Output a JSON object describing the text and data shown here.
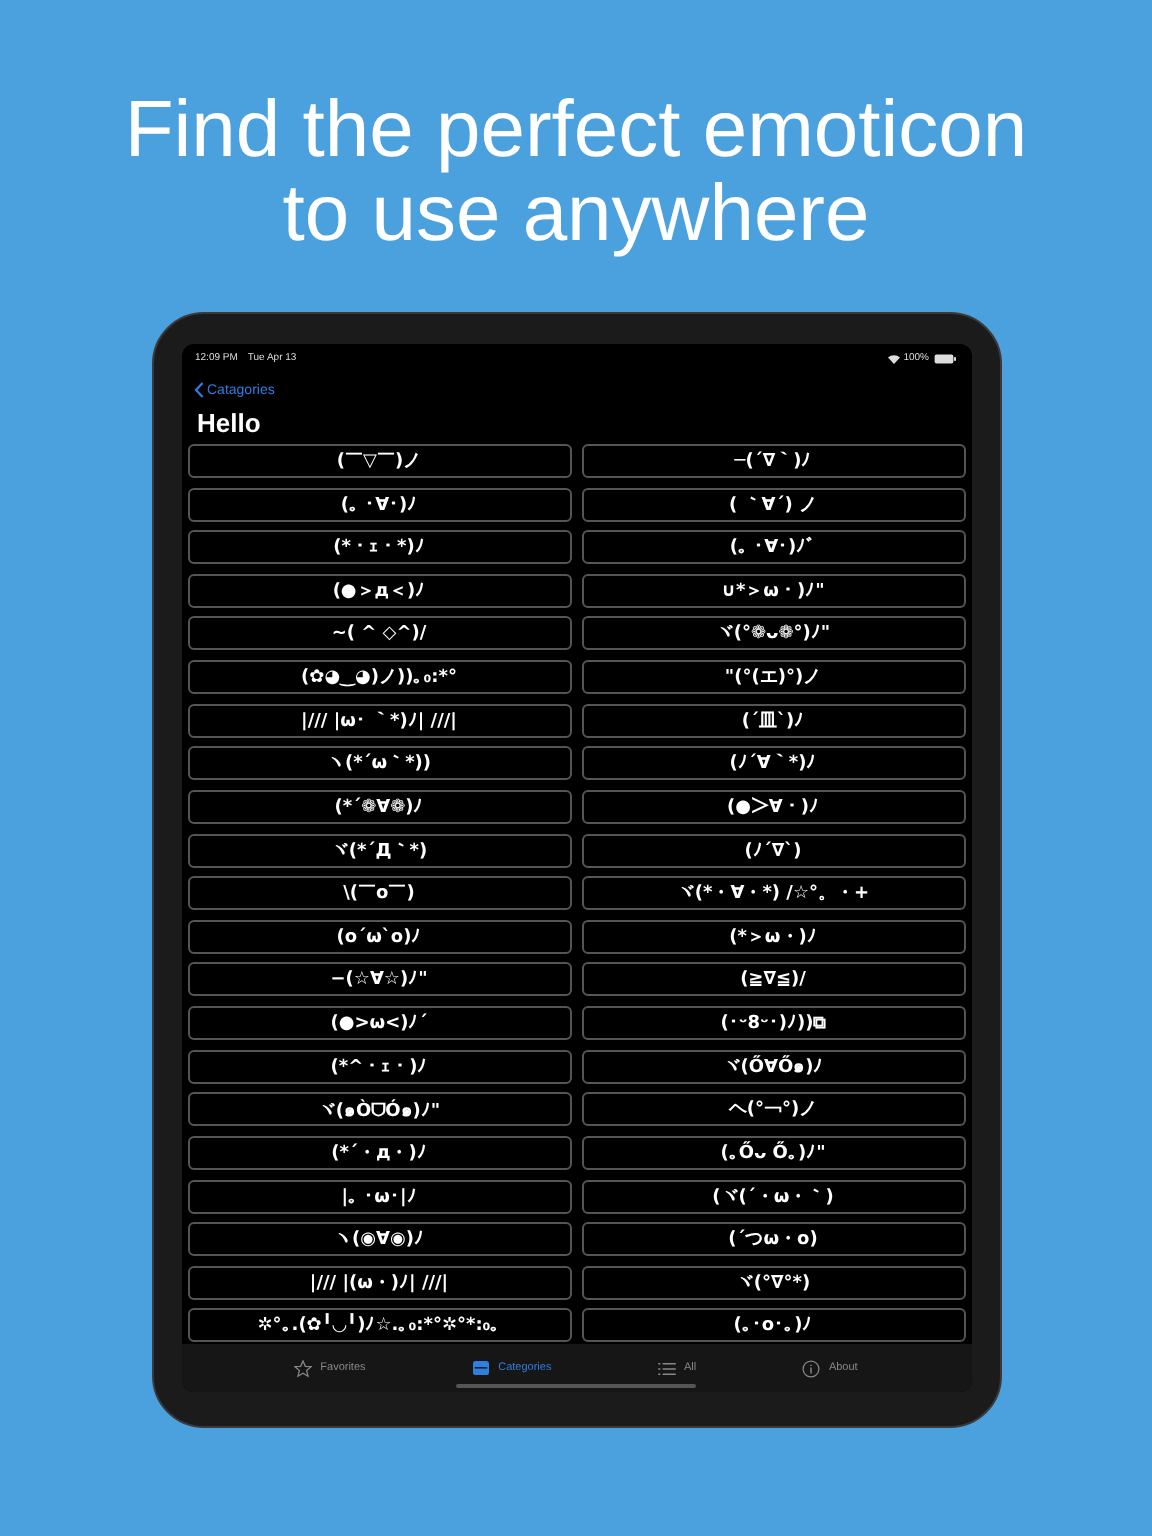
{
  "headline": [
    "Find the perfect emoticon",
    "to use anywhere"
  ],
  "status_bar": {
    "time": "12:09 PM",
    "date": "Tue Apr 13",
    "battery": "100%"
  },
  "nav": {
    "back": "Catagories",
    "title": "Hello"
  },
  "emoticons": [
    "(￣▽￣)ノ",
    "─(´∇｀)ﾉ",
    "(｡ ･∀･)ﾉ",
    "( ｀∀´) ノ",
    "(*・ｪ・*)ﾉ",
    "(｡ ･∀･)ﾉﾞ",
    "(●＞д＜)ﾉ",
    "∪*＞ω・)ﾉ\"",
    "~( ^ ◇^)/",
    "ヾ(°❁ᴗ❁°)ﾉ\"",
    "(✿◕‿◕)ノ))｡₀:*°",
    "\"(°(エ)°)ノ",
    "|/// |ω･ ｀*)ﾉ| ///|",
    "(ˊ皿ˋ)ﾉ",
    "ヽ(*´ω｀*))",
    "(ﾉ´∀｀*)ﾉ",
    "(*´❁∀❁)ﾉ",
    "(●＞∀・)ﾉ",
    "ヾ(*´Д｀*)",
    "(ﾉ´∇`)",
    "\\(￣o￣)",
    "ヾ(*・∀・*) /☆°。・+",
    "(o´ω`o)ﾉ",
    "(*＞ω・)ﾉ",
    "−(☆∀☆)ﾉ\"",
    "(≧∇≦)/",
    "(●>ω<)ﾉ´",
    "(･ᵕ8ᵕ･)ﾉ))⧉",
    "(*^・ｪ・)ﾉ",
    "ヾ(Ő∀Ő๑)ﾉ",
    "ヾ(๑ÒᗜÓ๑)ﾉ\"",
    "ヘ(°￢°)ノ",
    "(*´・д・)ﾉ",
    "(｡Őᴗ Ő｡)ﾉ\"",
    "|｡ ･ω･|ﾉ",
    "(ヾ(´・ω・｀)",
    "ヽ(◉∀◉)ﾉ",
    "(´つω・o)",
    "|/// |(ω・)ﾉ| ///|",
    "ヾ(°∇°*)",
    "✲°｡.(✿╹◡╹)ﾉ☆.｡₀:*°✲°*:₀｡",
    "(｡･o･｡)ﾉ"
  ],
  "tabs": [
    {
      "kind": "star",
      "label": "Favorites",
      "selected": false
    },
    {
      "kind": "folder",
      "label": "Categories",
      "selected": true
    },
    {
      "kind": "list",
      "label": "All",
      "selected": false
    },
    {
      "kind": "info",
      "label": "About",
      "selected": false
    }
  ]
}
